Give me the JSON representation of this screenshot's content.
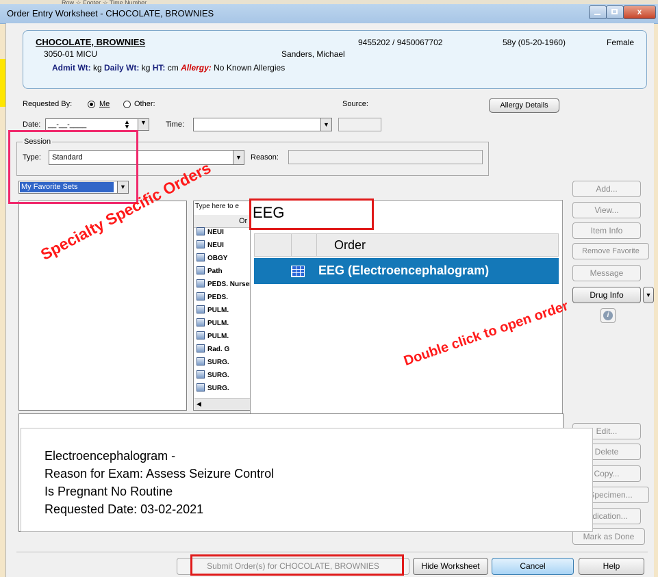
{
  "window": {
    "title": "Order Entry Worksheet - CHOCOLATE, BROWNIES",
    "background_strip_text": "Row   ☆ Footer        ☆ Time Number"
  },
  "patient": {
    "name": "CHOCOLATE, BROWNIES",
    "unit": "3050-01 MICU",
    "physician": "Sanders, Michael",
    "ids": "9455202 / 9450067702",
    "age": "58y (05-20-1960)",
    "sex": "Female",
    "admit_wt_label": "Admit Wt:",
    "admit_wt_unit": "kg",
    "daily_wt_label": "Daily Wt:",
    "daily_wt_unit": "kg",
    "ht_label": "HT:",
    "ht_unit": "cm",
    "allergy_label": "Allergy:",
    "allergy_value": "No Known Allergies"
  },
  "form": {
    "requested_by_label": "Requested By:",
    "opt_me": "Me",
    "opt_other": "Other:",
    "source_label": "Source:",
    "allergy_details_btn": "Allergy Details",
    "date_label": "Date:",
    "date_value": "__-__-____",
    "time_label": "Time:",
    "session_label": "Session",
    "type_label": "Type:",
    "type_value": "Standard",
    "reason_label": "Reason:",
    "favorites_value": "My Favorite Sets"
  },
  "search": {
    "placeholder_partial": "Type here to e",
    "column_header_partial": "Or",
    "list_items": [
      "NEUI",
      "NEUI",
      "OBGY",
      "Path",
      "PEDS. Nursery Discharge",
      "PEDS. ",
      "PULM.",
      "PULM.",
      "PULM.",
      "Rad. G",
      "SURG.",
      "SURG.",
      "SURG."
    ]
  },
  "zoom_view": {
    "search_text": "EEG",
    "column_order": "Order",
    "result": "EEG (Electroencephalogram)"
  },
  "right_buttons": {
    "add": "Add...",
    "view": "View...",
    "item_info": "Item Info",
    "remove_favorite": "Remove Favorite",
    "message": "Message",
    "drug_info": "Drug Info",
    "edit": "Edit...",
    "delete": "Delete",
    "copy": "Copy...",
    "specimen": "Specimen...",
    "indication": "Indication...",
    "mark_as_done": "Mark as Done"
  },
  "order_detail": {
    "line1": "Electroencephalogram -",
    "line2": "Reason for Exam: Assess Seizure Control",
    "line3": "Is Pregnant No  Routine",
    "line4": "Requested Date: 03-02-2021"
  },
  "bottom": {
    "submit": "Submit Order(s) for CHOCOLATE, BROWNIES",
    "hide_worksheet": "Hide Worksheet",
    "cancel": "Cancel",
    "help": "Help"
  },
  "annotations": {
    "specialty": "Specialty Specific Orders",
    "double_click": "Double click to open order"
  },
  "colors": {
    "annotation_red": "#ff1a1a",
    "highlight_pink": "#f0296c",
    "selection_blue": "#1478b8",
    "allergy_red": "#d00000"
  }
}
